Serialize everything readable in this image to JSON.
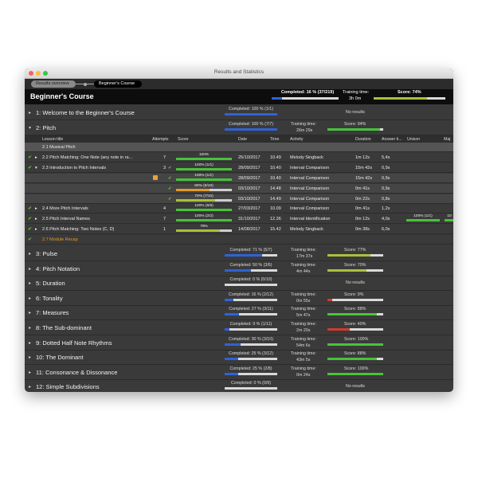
{
  "window": {
    "title": "Results and Statistics"
  },
  "breadcrumbs": [
    "Results overview",
    "Beginner's Course"
  ],
  "course": {
    "title": "Beginner's Course",
    "completed_label": "Completed: 16 %  (37/219)",
    "completed_fraction": 0.16,
    "training_label": "Training time:",
    "training_value": "3h 0m",
    "score_label": "Score: 74%",
    "score_fraction": 0.74
  },
  "chapters_top": [
    {
      "title": "1: Welcome to the Beginner's Course",
      "completed": "Completed: 100 %  (1/1)",
      "completed_fraction": 1.0,
      "no_results": "No results"
    },
    {
      "title": "2: Pitch",
      "completed": "Completed: 100 %  (7/7)",
      "completed_fraction": 1.0,
      "training_label": "Training time:",
      "training_value": "26m 29s",
      "score": "Score: 94%",
      "score_fraction": 0.94,
      "score_color": "#49c23b"
    }
  ],
  "table_headers": [
    "Lesson title",
    "Attempts",
    "Score",
    "Date",
    "Time",
    "Activity",
    "Duration",
    "Answer ti...",
    "Unison",
    "Maj"
  ],
  "lessons": [
    {
      "kind": "section",
      "title": "2.1 Musical Pitch"
    },
    {
      "kind": "lesson",
      "arrow": "▸",
      "title": "2.2 Pitch Matching: One Note (any note in ra...",
      "attempts": "7",
      "score": "100%",
      "score_fraction": 1.0,
      "score_color": "#49c23b",
      "date": "25/10/2017",
      "time": "10.49",
      "activity": "Melody Singback",
      "duration": "1m 12s",
      "answer": "5,4s"
    },
    {
      "kind": "lesson",
      "arrow": "▾",
      "title": "2.3 Introduction to Pitch Intervals",
      "attempts": "3",
      "score": "100% (1/1)",
      "score_fraction": 1.0,
      "score_color": "#49c23b",
      "date": "28/09/2017",
      "time": "10.40",
      "activity": "Interval Comparison",
      "duration": "15m 42s",
      "answer": "0,9s"
    },
    {
      "kind": "attempt",
      "score": "100% (1/1)",
      "score_fraction": 1.0,
      "score_color": "#49c23b",
      "date": "28/09/2017",
      "time": "10.40",
      "activity": "Interval Comparison",
      "duration": "15m 42s",
      "answer": "0,9s",
      "trophy": true
    },
    {
      "kind": "attempt",
      "score": "60% (6/10)",
      "score_fraction": 0.6,
      "score_color": "#e39a2b",
      "date": "03/10/2017",
      "time": "14.48",
      "activity": "Interval Comparison",
      "duration": "0m 41s",
      "answer": "0,9s"
    },
    {
      "kind": "attempt",
      "score": "70% (7/10)",
      "score_fraction": 0.7,
      "score_color": "#a8c23b",
      "date": "03/10/2017",
      "time": "14.49",
      "activity": "Interval Comparison",
      "duration": "0m 22s",
      "answer": "0,8s"
    },
    {
      "kind": "lesson",
      "arrow": "▸",
      "title": "2.4 More Pitch Intervals",
      "attempts": "4",
      "score": "100% (5/5)",
      "score_fraction": 1.0,
      "score_color": "#49c23b",
      "date": "27/03/2017",
      "time": "10.09",
      "activity": "Interval Comparison",
      "duration": "0m 41s",
      "answer": "1,2s"
    },
    {
      "kind": "lesson",
      "arrow": "▸",
      "title": "2.5 Pitch Interval Names",
      "attempts": "7",
      "score": "100% (2/2)",
      "score_fraction": 1.0,
      "score_color": "#49c23b",
      "date": "31/10/2017",
      "time": "12.36",
      "activity": "Interval Identification",
      "duration": "0m 12s",
      "answer": "4,0s",
      "unison": "100% (1/1)",
      "unison_fraction": 1.0,
      "maj": "10"
    },
    {
      "kind": "lesson",
      "arrow": "▸",
      "title": "2.6 Pitch Matching: Two Notes (C, D)",
      "attempts": "1",
      "score": "79%",
      "score_fraction": 0.79,
      "score_color": "#a8c23b",
      "date": "14/08/2017",
      "time": "15.42",
      "activity": "Melody Singback",
      "duration": "0m 38s",
      "answer": "6,0s"
    },
    {
      "kind": "recap",
      "title": "2.7 Module Recap"
    }
  ],
  "chapters_bottom": [
    {
      "title": "3: Pulse",
      "completed": "Completed: 71 %  (5/7)",
      "completed_fraction": 0.71,
      "training_label": "Training time:",
      "training_value": "17m 37s",
      "score": "Score: 77%",
      "score_fraction": 0.77,
      "score_color": "#a8c23b"
    },
    {
      "title": "4: Pitch Notation",
      "completed": "Completed: 50 %  (3/6)",
      "completed_fraction": 0.5,
      "training_label": "Training time:",
      "training_value": "4m 44s",
      "score": "Score: 70%",
      "score_fraction": 0.7,
      "score_color": "#a8c23b"
    },
    {
      "title": "5: Duration",
      "completed": "Completed: 0 %  (0/10)",
      "completed_fraction": 0.0,
      "no_results": "No results"
    },
    {
      "title": "6: Tonality",
      "completed": "Completed: 16 %  (2/12)",
      "completed_fraction": 0.16,
      "training_label": "Training time:",
      "training_value": "0m 55s",
      "score": "Score: 9%",
      "score_fraction": 0.09,
      "score_color": "#d23a2b"
    },
    {
      "title": "7: Measures",
      "completed": "Completed: 27 %  (3/11)",
      "completed_fraction": 0.27,
      "training_label": "Training time:",
      "training_value": "5m 47s",
      "score": "Score: 88%",
      "score_fraction": 0.88,
      "score_color": "#49c23b"
    },
    {
      "title": "8: The Sub-dominant",
      "completed": "Completed: 9 %  (1/11)",
      "completed_fraction": 0.09,
      "training_label": "Training time:",
      "training_value": "2m 20s",
      "score": "Score: 40%",
      "score_fraction": 0.4,
      "score_color": "#d23a2b"
    },
    {
      "title": "9: Dotted Half Note Rhythms",
      "completed": "Completed: 30 %  (3/10)",
      "completed_fraction": 0.3,
      "training_label": "Training time:",
      "training_value": "54m 6s",
      "score": "Score: 100%",
      "score_fraction": 1.0,
      "score_color": "#49c23b"
    },
    {
      "title": "10: The Dominant",
      "completed": "Completed: 25 %  (3/12)",
      "completed_fraction": 0.25,
      "training_label": "Training time:",
      "training_value": "43m 5s",
      "score": "Score: 88%",
      "score_fraction": 0.88,
      "score_color": "#49c23b"
    },
    {
      "title": "11: Consonance & Dissonance",
      "completed": "Completed: 25 %  (2/8)",
      "completed_fraction": 0.25,
      "training_label": "Training time:",
      "training_value": "0m 24s",
      "score": "Score: 100%",
      "score_fraction": 1.0,
      "score_color": "#49c23b"
    },
    {
      "title": "12: Simple Subdivisions",
      "completed": "Completed: 0 %  (0/9)",
      "completed_fraction": 0.0,
      "no_results": "No results"
    }
  ],
  "colors": {
    "completed_blue": "#2f63d6",
    "window_bg": "#3a3a3a",
    "topbar_bg": "#0d0d0d",
    "recap_orange": "#e49a2b"
  }
}
